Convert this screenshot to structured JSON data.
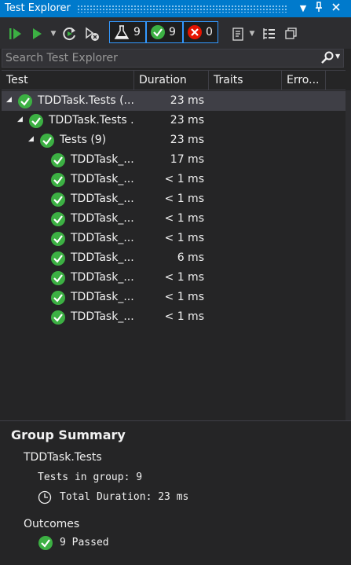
{
  "window": {
    "title": "Test Explorer",
    "pin_glyph": "▾",
    "close_glyph": "✕"
  },
  "toolbar": {
    "run_all_icon": "run-all-icon",
    "run_icon": "run-icon",
    "counters": {
      "total": "9",
      "passed": "9",
      "failed": "0"
    }
  },
  "search": {
    "placeholder": "Search Test Explorer"
  },
  "columns": {
    "test": "Test",
    "duration": "Duration",
    "traits": "Traits",
    "error": "Erro..."
  },
  "tree": [
    {
      "name": "TDDTask.Tests (...",
      "duration": "23 ms"
    },
    {
      "name": "TDDTask.Tests .",
      "duration": "23 ms"
    },
    {
      "name": "Tests  (9)",
      "duration": "23 ms"
    },
    {
      "name": "TDDTask_...",
      "duration": "17 ms"
    },
    {
      "name": "TDDTask_...",
      "duration": "< 1 ms"
    },
    {
      "name": "TDDTask_...",
      "duration": "< 1 ms"
    },
    {
      "name": "TDDTask_...",
      "duration": "< 1 ms"
    },
    {
      "name": "TDDTask_...",
      "duration": "< 1 ms"
    },
    {
      "name": "TDDTask_...",
      "duration": "6 ms"
    },
    {
      "name": "TDDTask_...",
      "duration": "< 1 ms"
    },
    {
      "name": "TDDTask_...",
      "duration": "< 1 ms"
    },
    {
      "name": "TDDTask_...",
      "duration": "< 1 ms"
    }
  ],
  "summary": {
    "title": "Group Summary",
    "group": "TDDTask.Tests",
    "tests_in_group": "Tests in group: 9",
    "total_duration": "Total Duration: 23 ms",
    "outcomes_label": "Outcomes",
    "passed": "9 Passed"
  },
  "colors": {
    "accent": "#007acc",
    "pass": "#3cb043",
    "fail": "#e51400",
    "bg": "#252526"
  }
}
